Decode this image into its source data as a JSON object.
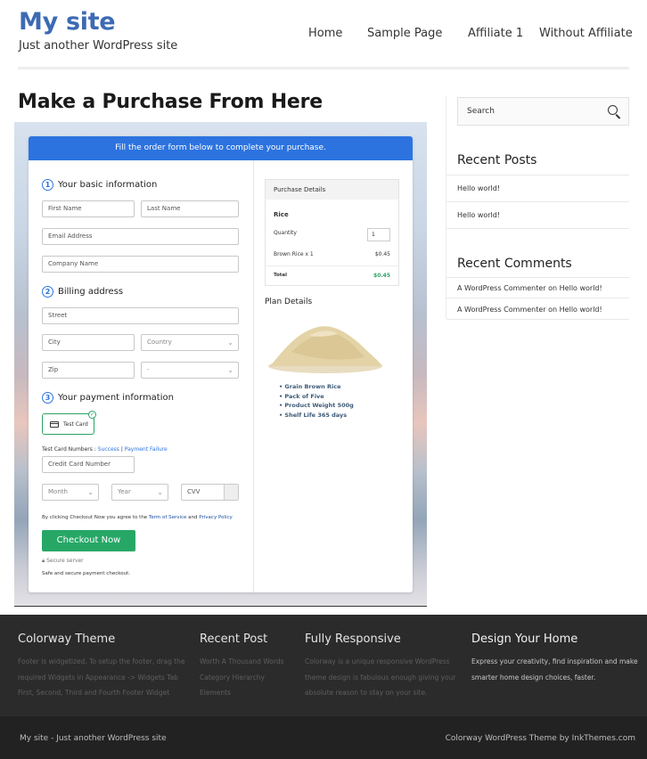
{
  "site": {
    "title": "My site",
    "tagline": "Just another WordPress site"
  },
  "nav": {
    "items": [
      "Home",
      "Sample Page",
      "Affiliate 1",
      "Without Affiliate"
    ]
  },
  "page": {
    "heading": "Make a Purchase From Here"
  },
  "form": {
    "banner": "Fill the order form below to complete your purchase.",
    "step1": {
      "num": "1",
      "label": "Your basic information"
    },
    "step2": {
      "num": "2",
      "label": "Billing address"
    },
    "step3": {
      "num": "3",
      "label": "Your payment information"
    },
    "first_name": "First Name",
    "last_name": "Last Name",
    "email": "Email Address",
    "company": "Company Name",
    "street": "Street",
    "city": "City",
    "country": "Country",
    "zip": "Zip",
    "state": "-",
    "test_card": "Test Card",
    "test_numbers_label": "Test Card Numbers :",
    "success_link": "Success",
    "sep": "|",
    "failure_link": "Payment Failure",
    "card_number": "Credit Card Number",
    "month": "Month",
    "year": "Year",
    "cvv": "CVV",
    "terms_prefix": "By clicking Checkout Now you agree to the",
    "terms_link": "Term of Service",
    "terms_and": "and",
    "privacy_link": "Privacy Policy",
    "checkout_button": "Checkout Now",
    "secure_server": "Secure server",
    "secure_note": "Safe and secure payment checkout."
  },
  "purchase": {
    "header": "Purchase Details",
    "product": "Rice",
    "quantity_label": "Quantity",
    "quantity_value": "1",
    "line_item": "Brown Rice x 1",
    "line_price": "$0.45",
    "total_label": "Total",
    "total_value": "$0.45"
  },
  "plan": {
    "title": "Plan Details",
    "bullets": [
      "Grain Brown Rice",
      "Pack of Five",
      "Product Weight 500g",
      "Shelf Life 365 days"
    ]
  },
  "sidebar": {
    "search_placeholder": "Search",
    "recent_posts_title": "Recent Posts",
    "recent_posts": [
      "Hello world!",
      "Hello world!"
    ],
    "recent_comments_title": "Recent Comments",
    "recent_comments": [
      {
        "author": "A WordPress Commenter",
        "on": "on",
        "post": "Hello world!"
      },
      {
        "author": "A WordPress Commenter",
        "on": "on",
        "post": "Hello world!"
      }
    ]
  },
  "footer": {
    "col1": {
      "title": "Colorway Theme",
      "lines": [
        "Footer is widgetized. To setup the footer, drag the",
        "required Widgets in Appearance -> Widgets Tab",
        "First, Second, Third and Fourth Footer Widget"
      ]
    },
    "col2": {
      "title": "Recent Post",
      "lines": [
        "Worth A Thousand Words",
        "Category Hierarchy",
        "Elements"
      ]
    },
    "col3": {
      "title": "Fully Responsive",
      "lines": [
        "Colorway is a unique responsive WordPress",
        "theme design is fabulous enough giving your",
        "absolute reason to stay on your site."
      ]
    },
    "col4": {
      "title": "Design Your Home",
      "lines": [
        "Express your creativity, find inspiration and make",
        "smarter home design choices, faster."
      ]
    },
    "bottom_left": "My site - Just another WordPress site",
    "bottom_right": "Colorway WordPress Theme by InkThemes.com"
  },
  "colors": {
    "brand_blue": "#3d6ab3",
    "banner_blue": "#2c73e0",
    "checkout_green": "#27a766",
    "footer_bg": "#2b2b2b"
  },
  "icons": {
    "search": "search-icon",
    "card": "credit-card-icon",
    "check": "check-icon",
    "lock": "lock-icon"
  }
}
